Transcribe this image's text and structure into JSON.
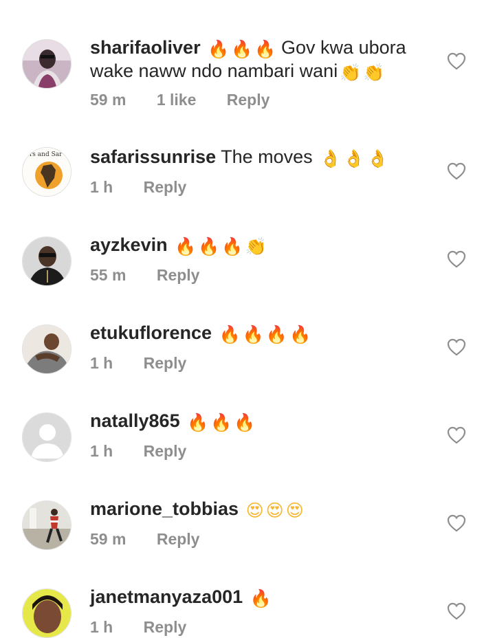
{
  "comments": [
    {
      "username": "sharifaoliver",
      "emojis_pre": [
        "🔥",
        "🔥",
        "🔥"
      ],
      "text": "Gov kwa ubora wake naww ndo nambari wani",
      "emojis_post": [
        "👏",
        "👏"
      ],
      "time": "59 m",
      "likes": "1 like",
      "reply": "Reply"
    },
    {
      "username": "safarissunrise",
      "text": "The moves",
      "emojis_post": [
        "👌",
        "👌",
        "👌"
      ],
      "time": "1 h",
      "reply": "Reply",
      "avatar_text": "rs and Sar"
    },
    {
      "username": "ayzkevin",
      "emojis_post": [
        "🔥",
        "🔥",
        "🔥",
        "👏"
      ],
      "time": "55 m",
      "reply": "Reply"
    },
    {
      "username": "etukuflorence",
      "emojis_post": [
        "🔥",
        "🔥",
        "🔥",
        "🔥"
      ],
      "time": "1 h",
      "reply": "Reply"
    },
    {
      "username": "natally865",
      "emojis_post": [
        "🔥",
        "🔥",
        "🔥"
      ],
      "time": "1 h",
      "reply": "Reply"
    },
    {
      "username": "marione_tobbias",
      "emojis_post": [
        "😍",
        "😍",
        "😍"
      ],
      "time": "59 m",
      "reply": "Reply"
    },
    {
      "username": "janetmanyaza001",
      "emojis_post": [
        "🔥"
      ],
      "time": "1 h",
      "reply": "Reply"
    }
  ],
  "colors": {
    "username": "#262626",
    "text": "#262626",
    "meta": "#8e8e8e",
    "heart_outline": "#8e8e8e"
  },
  "icons": {
    "like": "heart-outline-icon"
  }
}
